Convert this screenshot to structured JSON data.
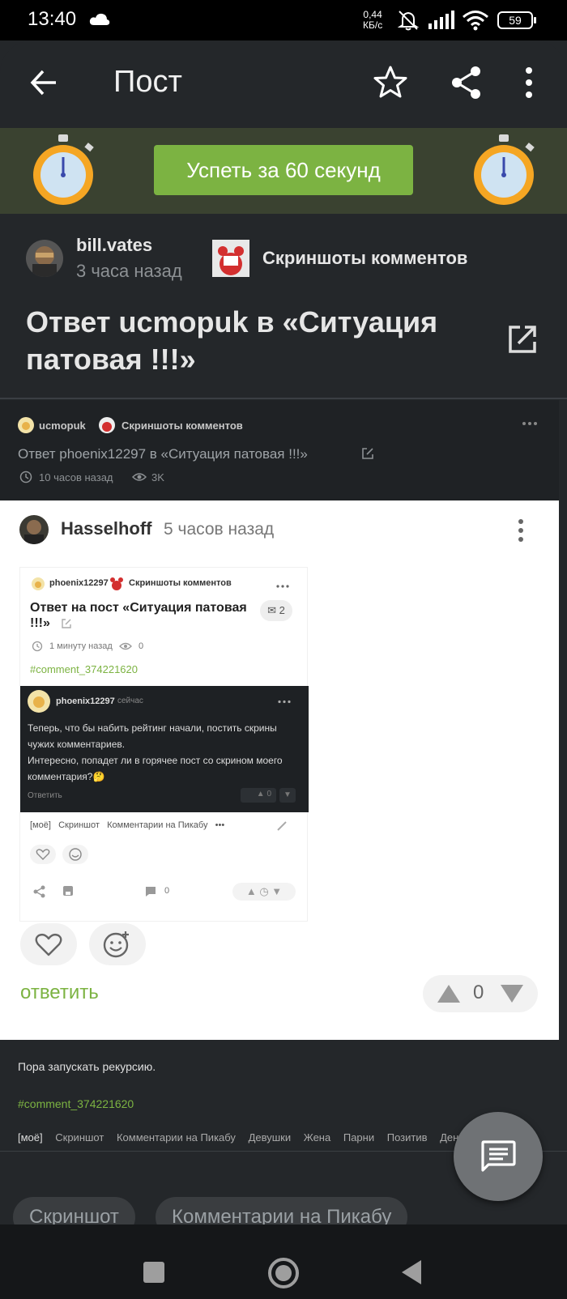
{
  "status_bar": {
    "time": "13:40",
    "net_rate_value": "0,44",
    "net_rate_unit": "КБ/с",
    "battery": "59"
  },
  "app_bar": {
    "title": "Пост"
  },
  "promo": {
    "button_label": "Успеть за 60 секунд"
  },
  "post": {
    "author": "bill.vates",
    "time": "3 часа назад",
    "community": "Скриншоты комментов",
    "community_logo_text": "Print Screen Baby",
    "title": "Ответ ucmopuk в «Ситуация патовая !!!»"
  },
  "inner_comment": {
    "author": "ucmopuk",
    "community": "Скриншоты комментов",
    "title": "Ответ phoenix12297 в «Ситуация патовая !!!»",
    "time": "10 часов назад",
    "views": "3K"
  },
  "comment": {
    "author": "Hasselhoff",
    "time": "5 часов назад",
    "reply_label": "ответить",
    "rating": "0",
    "screenshot": {
      "author": "phoenix12297",
      "community": "Скриншоты комментов",
      "title": "Ответ на пост «Ситуация патовая !!!»",
      "comments_count": "2",
      "time": "1 минуту назад",
      "views": "0",
      "hashtag": "#comment_374221620",
      "inner_author": "phoenix12297",
      "inner_time": "сейчас",
      "inner_text_1": "Теперь, что бы набить рейтинг начали, постить скрины чужих комментариев.",
      "inner_text_2": "Интересно, попадет ли в горячее пост со скрином моего комментария?🤔",
      "inner_reply": "Ответить",
      "inner_rating": "0",
      "tags": [
        "[моё]",
        "Скриншот",
        "Комментарии на Пикабу",
        "•••"
      ],
      "comment_count_bottom": "0"
    }
  },
  "lower": {
    "text": "Пора запускать рекурсию.",
    "hashtag": "#comment_374221620",
    "tags": [
      "[моё]",
      "Скриншот",
      "Комментарии на Пикабу",
      "Девушки",
      "Жена",
      "Парни",
      "Позитив",
      "Деньги"
    ]
  },
  "chips": [
    "Скриншот",
    "Комментарии на Пикабу"
  ],
  "colors": {
    "accent_green": "#7cb342",
    "background": "#24272a",
    "promo_bg": "#3a4230"
  }
}
